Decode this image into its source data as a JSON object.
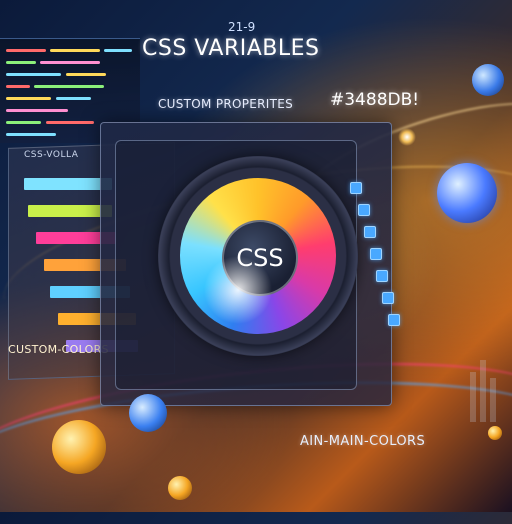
{
  "header": {
    "title": "CSS VARIABLES",
    "small_number": "21-9",
    "subtitle": "CUSTOM PROPERITES",
    "hex_code": "#3488DB!"
  },
  "swatch_panel": {
    "title": "CSS-VOLLA",
    "footer_label": "CUSTOM-COLORS",
    "swatch_colors": [
      "#7fe3ff",
      "#c9f04a",
      "#ff3e9a",
      "#ffa23a",
      "#5fd0ff",
      "#ffb02e",
      "#9a7cf0"
    ]
  },
  "color_wheel": {
    "center_label": "CSS"
  },
  "bottom": {
    "label": "AIN-MAIN-COLORS"
  },
  "colors": {
    "accent_blue": "#3488db",
    "glow_orange": "#ffb347"
  }
}
